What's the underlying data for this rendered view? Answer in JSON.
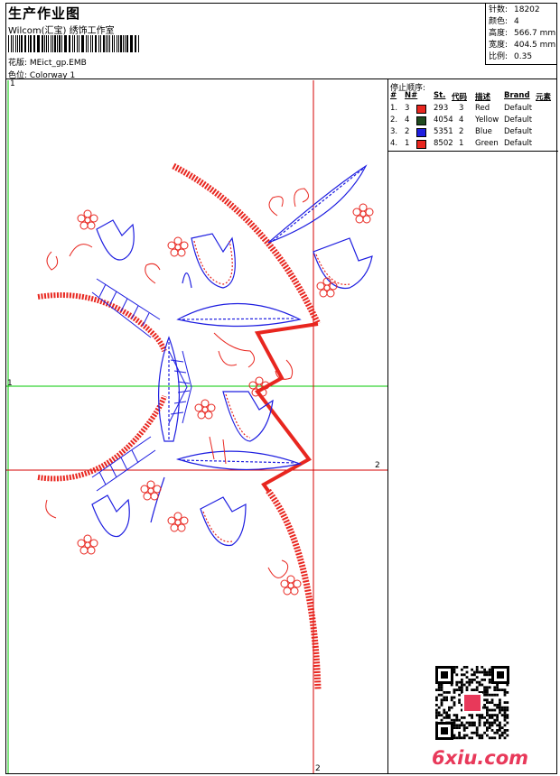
{
  "header": {
    "title": "生产作业图",
    "company": "Wilcom(汇宝) 绣饰工作室",
    "design_label": "花版:",
    "design_value": "MEict_gp.EMB",
    "colorway_label": "色位:",
    "colorway_value": "Colorway 1"
  },
  "stats": [
    {
      "label": "针数:",
      "value": "18202"
    },
    {
      "label": "颜色:",
      "value": "4"
    },
    {
      "label": "高度:",
      "value": "566.7 mm"
    },
    {
      "label": "宽度:",
      "value": "404.5 mm"
    },
    {
      "label": "比例:",
      "value": "0.35"
    }
  ],
  "stop_sequence": {
    "title": "停止顺序:",
    "headers": {
      "num": "#",
      "n": "N#",
      "st": "St.",
      "code": "代码",
      "desc": "描述",
      "brand": "Brand",
      "element": "元素"
    },
    "rows": [
      {
        "num": "1.",
        "n": "3",
        "color": "#e8261f",
        "st": "293",
        "code": "3",
        "desc": "Red",
        "brand": "Default"
      },
      {
        "num": "2.",
        "n": "4",
        "color": "#1f4a1f",
        "st": "4054",
        "code": "4",
        "desc": "Yellow",
        "brand": "Default"
      },
      {
        "num": "3.",
        "n": "2",
        "color": "#1e1ee0",
        "st": "5351",
        "code": "2",
        "desc": "Blue",
        "brand": "Default"
      },
      {
        "num": "4.",
        "n": "1",
        "color": "#e8261f",
        "st": "8502",
        "code": "1",
        "desc": "Green",
        "brand": "Default"
      }
    ]
  },
  "guides": {
    "top_left": "1",
    "left_mid": "1",
    "right_mid": "2",
    "bottom": "2"
  },
  "colors": {
    "thread_red": "#e8261f",
    "thread_blue": "#1e1ee0",
    "guide_green": "#00c800",
    "guide_red": "#d40000",
    "watermark": "#e8395a"
  },
  "watermark": "6xiu.com"
}
